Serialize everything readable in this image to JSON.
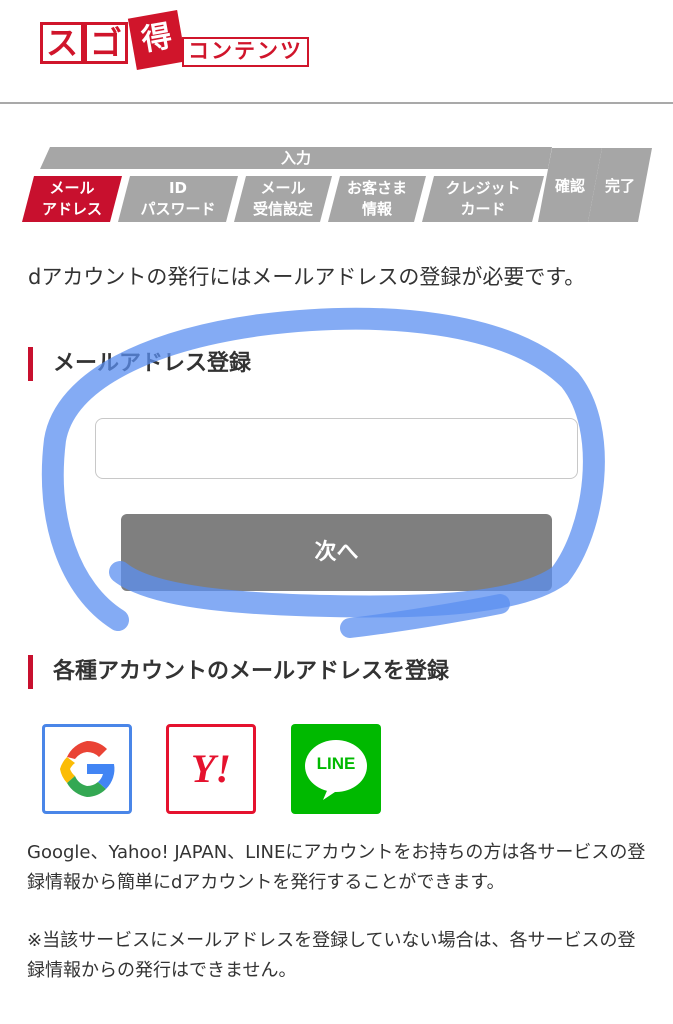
{
  "header": {
    "logo_text_1": "ス",
    "logo_text_2": "ゴ",
    "logo_text_3": "得",
    "logo_text_4": "コンテンツ"
  },
  "steps": {
    "group_label": "入力",
    "items": [
      {
        "line1": "メール",
        "line2": "アドレス",
        "active": true
      },
      {
        "line1": "ID",
        "line2": "パスワード",
        "active": false
      },
      {
        "line1": "メール",
        "line2": "受信設定",
        "active": false
      },
      {
        "line1": "お客さま",
        "line2": "情報",
        "active": false
      },
      {
        "line1": "クレジット",
        "line2": "カード",
        "active": false
      }
    ],
    "confirm_label": "確認",
    "complete_label": "完了"
  },
  "intro_text": "dアカウントの発行にはメールアドレスの登録が必要です。",
  "email_section": {
    "title": "メールアドレス登録",
    "input_value": "",
    "input_placeholder": "",
    "next_label": "次へ"
  },
  "social_section": {
    "title": "各種アカウントのメールアドレスを登録",
    "icons": [
      "google-icon",
      "yahoo-icon",
      "line-icon"
    ],
    "yahoo_text": "Y!",
    "line_text": "LINE"
  },
  "notes": {
    "note1": "Google、Yahoo! JAPAN、LINEにアカウントをお持ちの方は各サービスの登録情報から簡単にdアカウントを発行することができます。",
    "note2": "※当該サービスにメールアドレスを登録していない場合は、各サービスの登録情報からの発行はできません。"
  },
  "colors": {
    "brand_red": "#c8102e",
    "step_gray": "#a6a6a6",
    "button_gray": "#7f7f7f",
    "marker_blue": "#5b8ff0",
    "line_green": "#00b900"
  }
}
